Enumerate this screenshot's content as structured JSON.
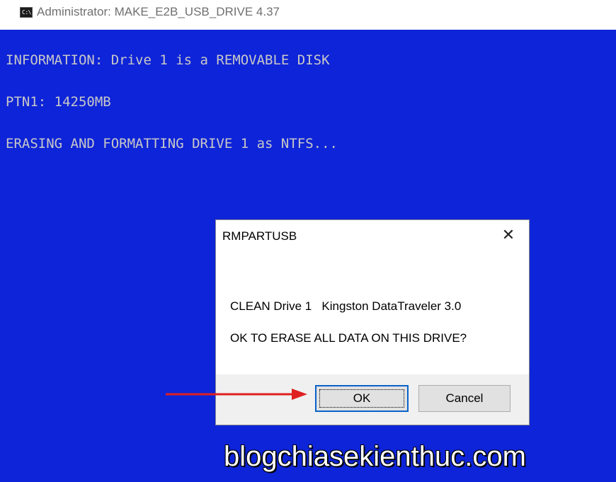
{
  "window": {
    "icon_label": "C:\\.",
    "title": "Administrator:  MAKE_E2B_USB_DRIVE 4.37"
  },
  "console": {
    "lines": [
      "INFORMATION: Drive 1 is a REMOVABLE DISK",
      "PTN1: 14250MB",
      "ERASING AND FORMATTING DRIVE 1 as NTFS..."
    ],
    "background_color": "#0e24d8",
    "text_color": "#c8c8c8"
  },
  "dialog": {
    "title": "RMPARTUSB",
    "close_symbol": "✕",
    "message_line1": "CLEAN Drive 1   Kingston DataTraveler 3.0",
    "message_line2": "OK TO ERASE ALL DATA ON THIS DRIVE?",
    "ok_label": "OK",
    "cancel_label": "Cancel"
  },
  "annotation": {
    "arrow_color": "#e02020",
    "arrow_target": "ok-button"
  },
  "watermark": "blogchiasekienthuc.com"
}
